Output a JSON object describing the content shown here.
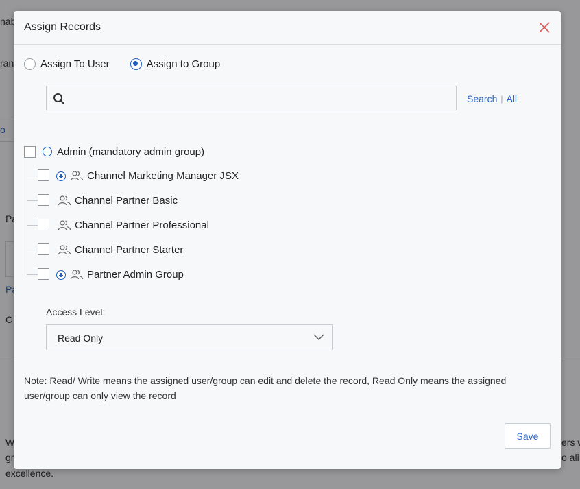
{
  "background": {
    "fragments": [
      "nab",
      "ran",
      "o",
      "Pa",
      "Pa",
      "C",
      "W",
      "gr",
      "ers w",
      "o ali",
      "excellence."
    ]
  },
  "modal": {
    "title": "Assign Records",
    "close_icon": "close-icon",
    "radios": [
      {
        "label": "Assign To User",
        "checked": false
      },
      {
        "label": "Assign to Group",
        "checked": true
      }
    ],
    "search": {
      "placeholder": "",
      "value": "",
      "search_link": "Search",
      "separator": "|",
      "all_link": "All"
    },
    "tree": {
      "root": {
        "label": "Admin (mandatory admin group)",
        "expanded": true,
        "checked": false
      },
      "children": [
        {
          "label": "Channel Marketing Manager JSX",
          "expandable": true,
          "checked": false
        },
        {
          "label": "Channel Partner Basic",
          "expandable": false,
          "checked": false
        },
        {
          "label": "Channel Partner Professional",
          "expandable": false,
          "checked": false
        },
        {
          "label": "Channel Partner Starter",
          "expandable": false,
          "checked": false
        },
        {
          "label": "Partner Admin Group",
          "expandable": true,
          "checked": false
        }
      ]
    },
    "access_level": {
      "label": "Access Level:",
      "selected": "Read Only"
    },
    "note": "Note: Read/ Write means the assigned user/group can edit and delete the record, Read Only means the assigned user/group can only view the record",
    "save_label": "Save",
    "colors": {
      "accent": "#1f5fbf",
      "link": "#2a66c9",
      "close": "#e05a5a"
    }
  }
}
